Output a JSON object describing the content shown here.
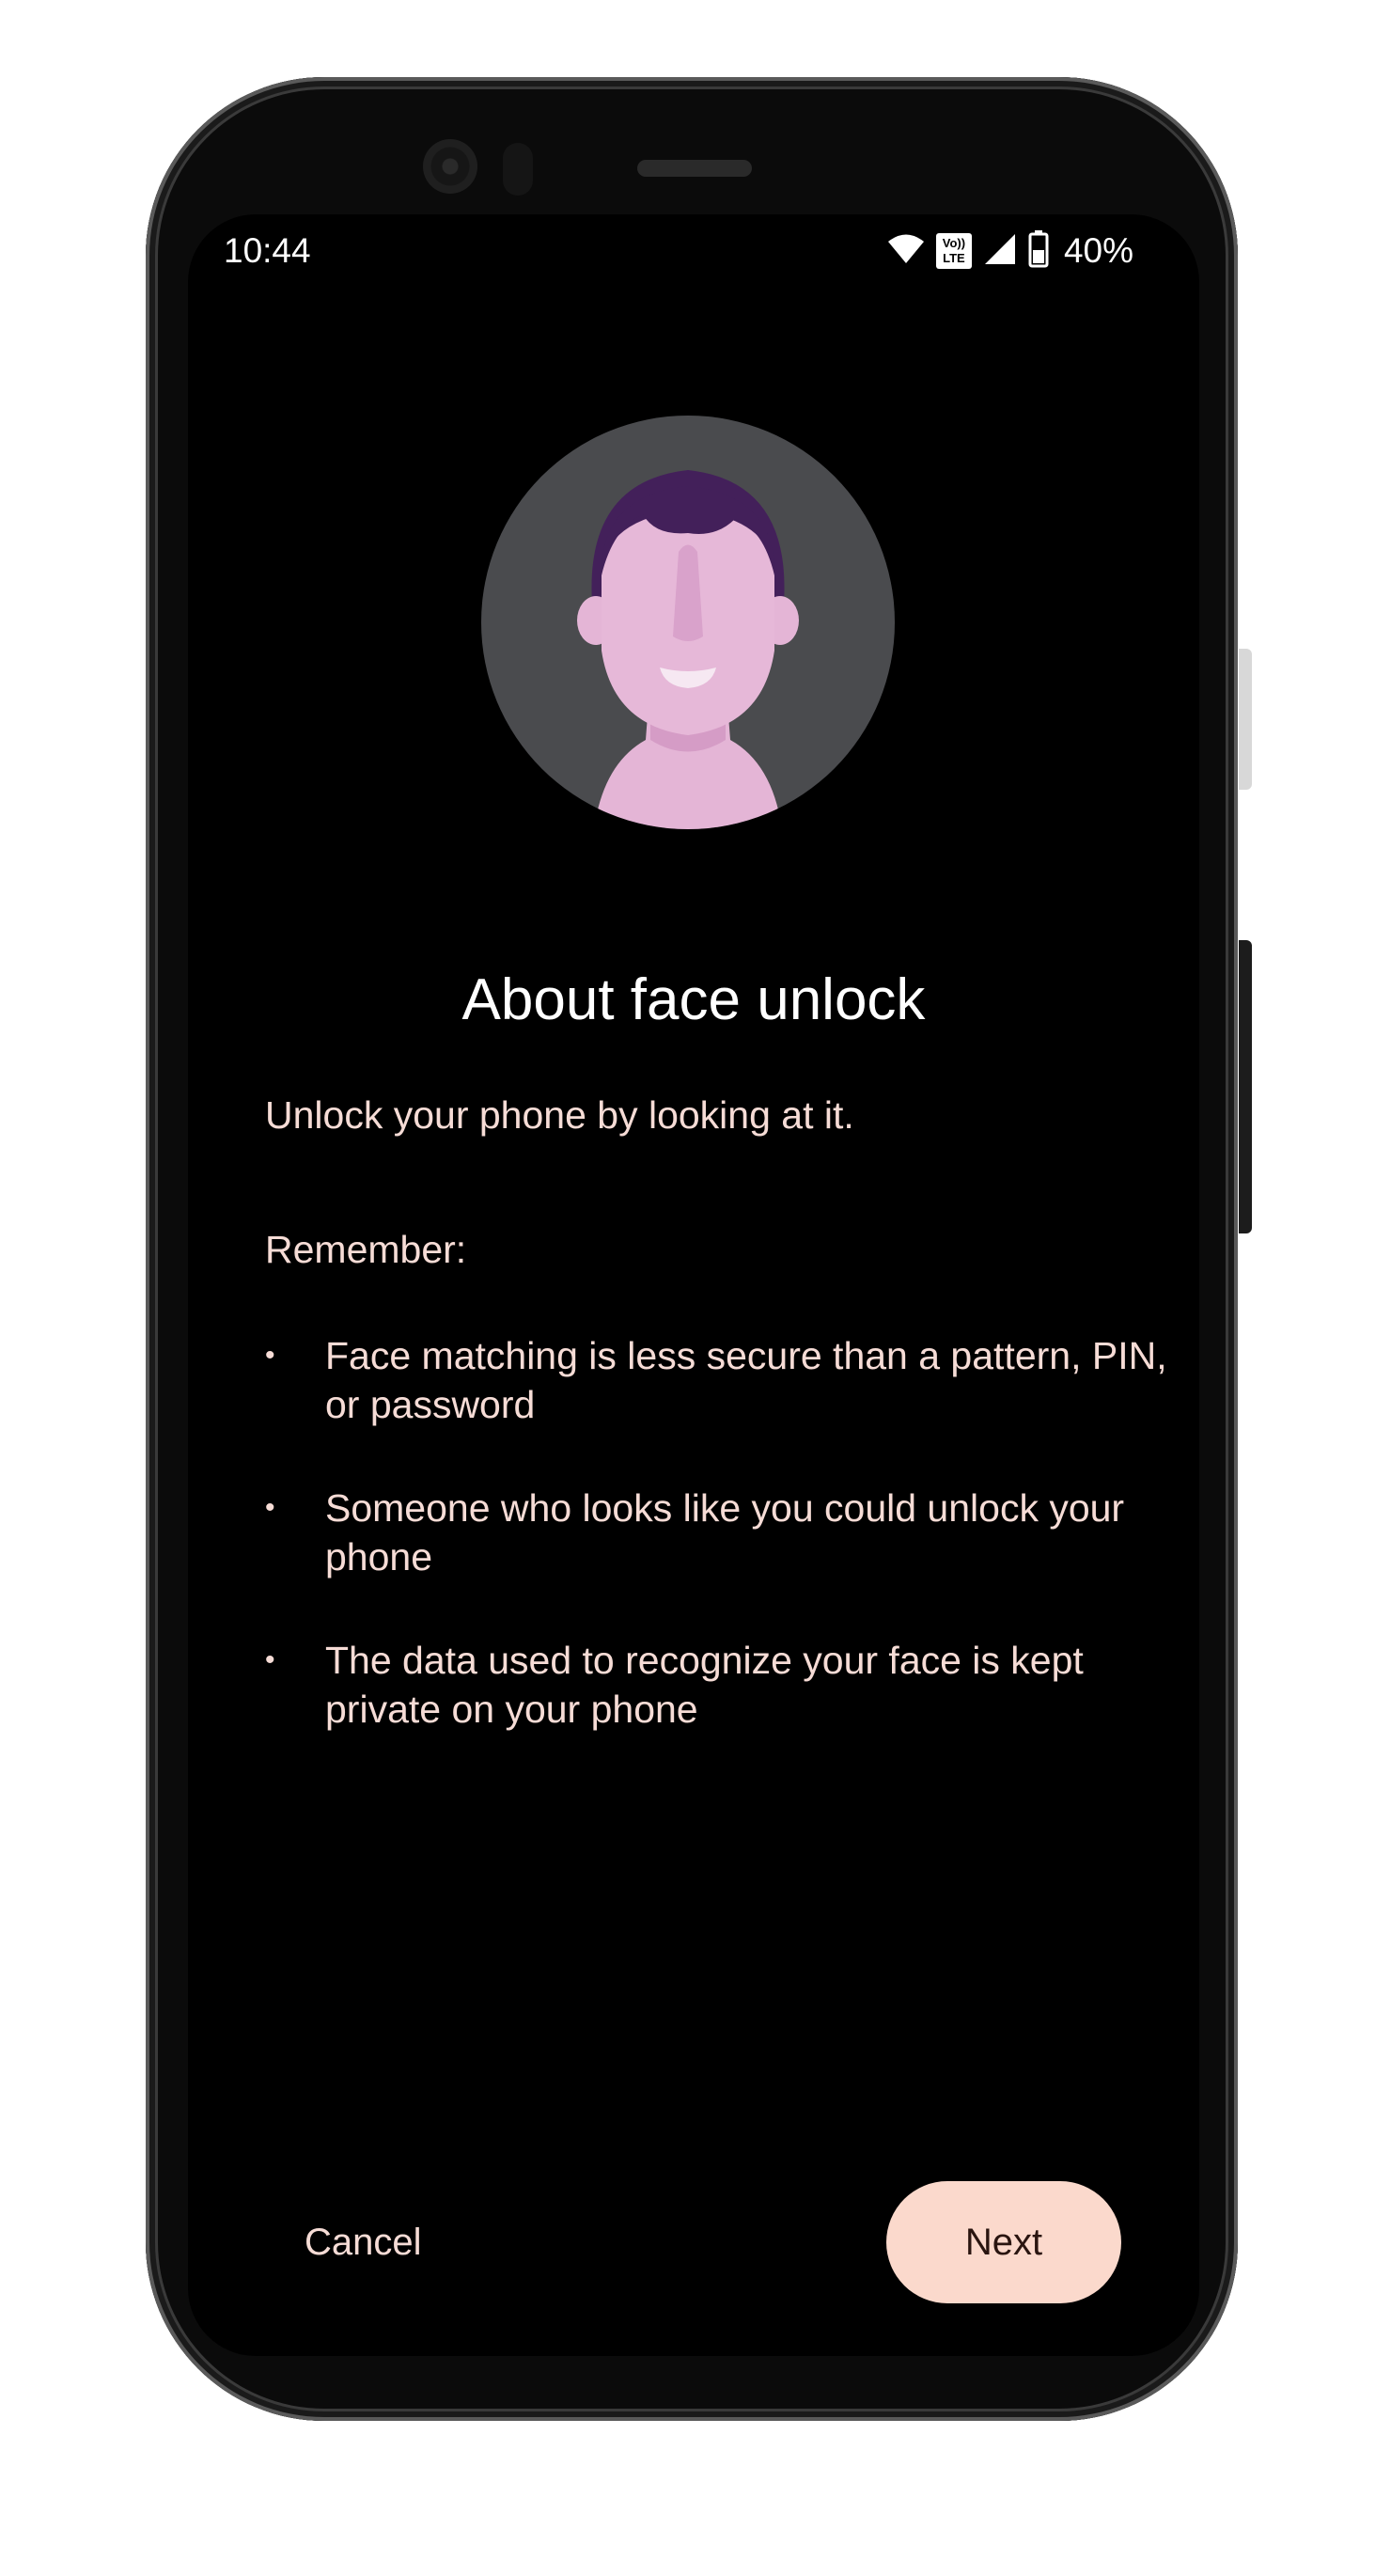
{
  "status_bar": {
    "time": "10:44",
    "volte_top": "Vo))",
    "volte_bottom": "LTE",
    "battery": "40%"
  },
  "content": {
    "title": "About face unlock",
    "intro": "Unlock your phone by looking at it.",
    "remember_label": "Remember:",
    "bullet_symbol": "•",
    "bullets": [
      "Face matching is less secure than a pattern, PIN, or password",
      "Someone who looks like you could unlock your phone",
      "The data used to recognize your face is kept private on your phone"
    ]
  },
  "actions": {
    "cancel_label": "Cancel",
    "next_label": "Next"
  },
  "colors": {
    "background": "#000000",
    "text": "#f6dcd6",
    "primary_button": "#fbd9cc",
    "avatar_bg": "#4a4b4e",
    "face": "#e6b8d8",
    "hair": "#43205a"
  }
}
